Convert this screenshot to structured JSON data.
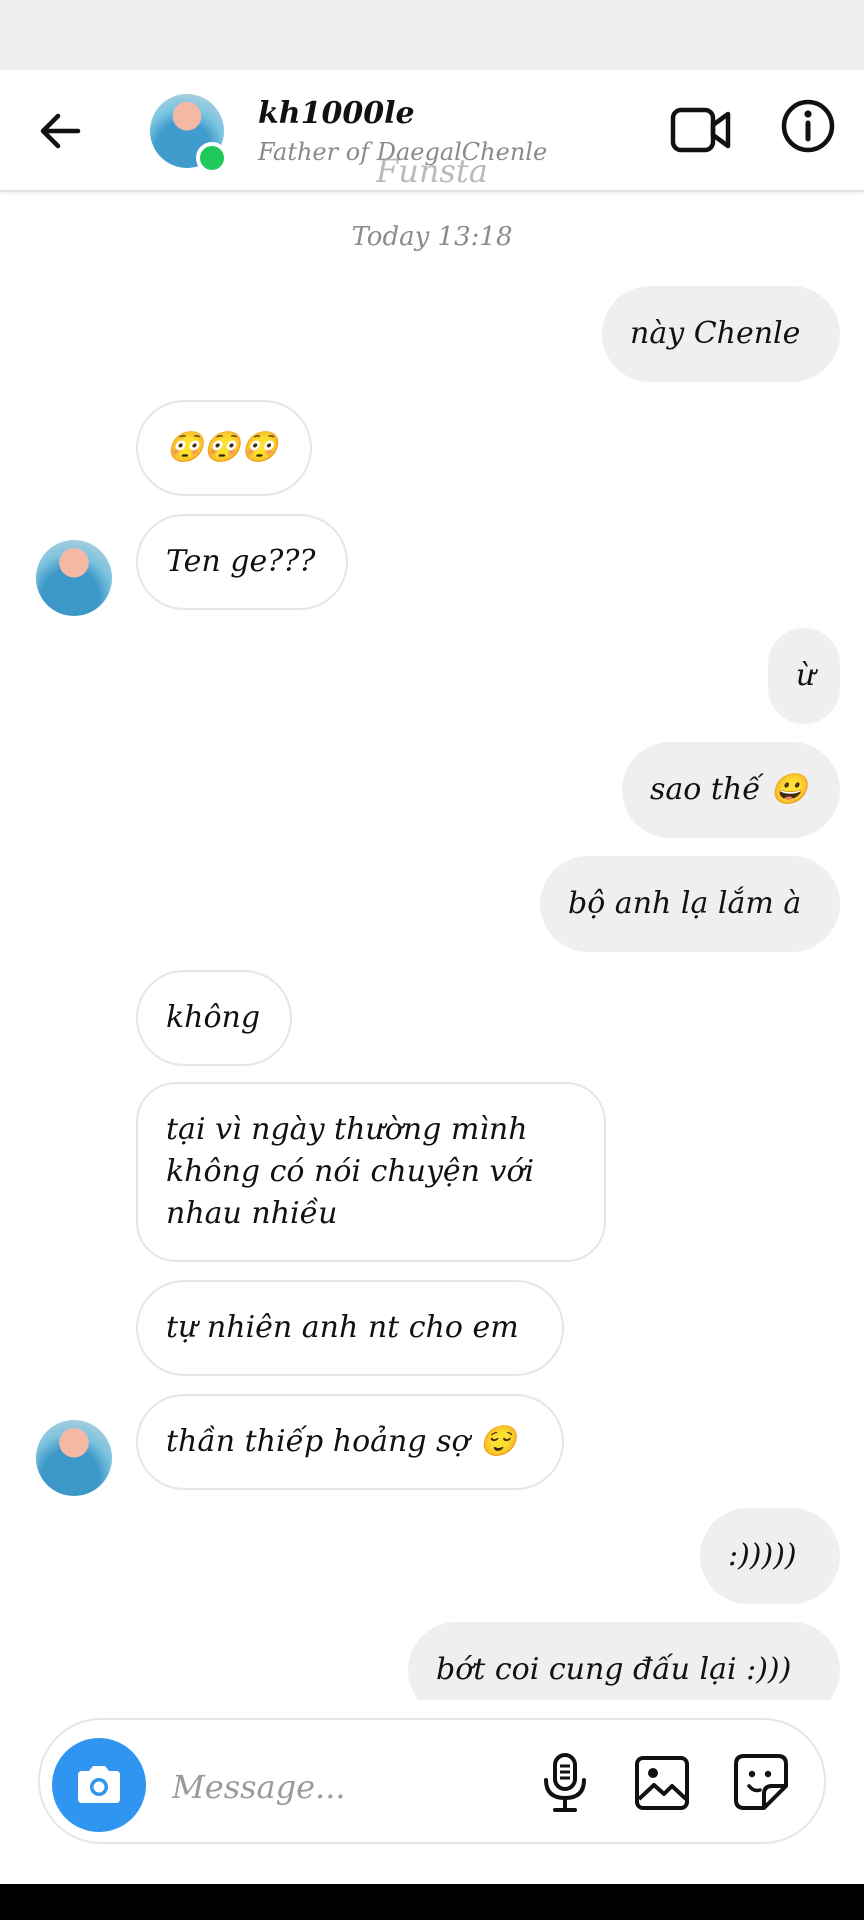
{
  "header": {
    "username": "kh1000le",
    "subtitle": "Father of DaegalChenle",
    "watermark": "Funsta"
  },
  "chat": {
    "timestamp": "Today 13:18",
    "messages": [
      {
        "from": "me",
        "text": "này Chenle"
      },
      {
        "from": "them",
        "text": "😳😳😳"
      },
      {
        "from": "them",
        "text": "Ten ge???"
      },
      {
        "from": "me",
        "text": "ừ"
      },
      {
        "from": "me",
        "text": "sao thế 😀"
      },
      {
        "from": "me",
        "text": "bộ anh lạ lắm à"
      },
      {
        "from": "them",
        "text": "không"
      },
      {
        "from": "them",
        "text": "tại vì ngày thường mình không có nói chuyện với nhau nhiều"
      },
      {
        "from": "them",
        "text": "tự nhiên anh nt cho em"
      },
      {
        "from": "them",
        "text": "thần thiếp hoảng sợ 😌"
      },
      {
        "from": "me",
        "text": ":)))))"
      },
      {
        "from": "me",
        "text": "bớt coi cung đấu lại :)))"
      }
    ]
  },
  "composer": {
    "placeholder": "Message..."
  },
  "icons": {
    "back": "arrow-left-icon",
    "video": "video-camera-icon",
    "info": "info-icon",
    "camera": "camera-icon",
    "mic": "microphone-icon",
    "gallery": "image-icon",
    "sticker": "sticker-icon"
  },
  "colors": {
    "accent": "#2f95f0",
    "online": "#1fc95b",
    "outgoing_bubble": "#efefef"
  }
}
